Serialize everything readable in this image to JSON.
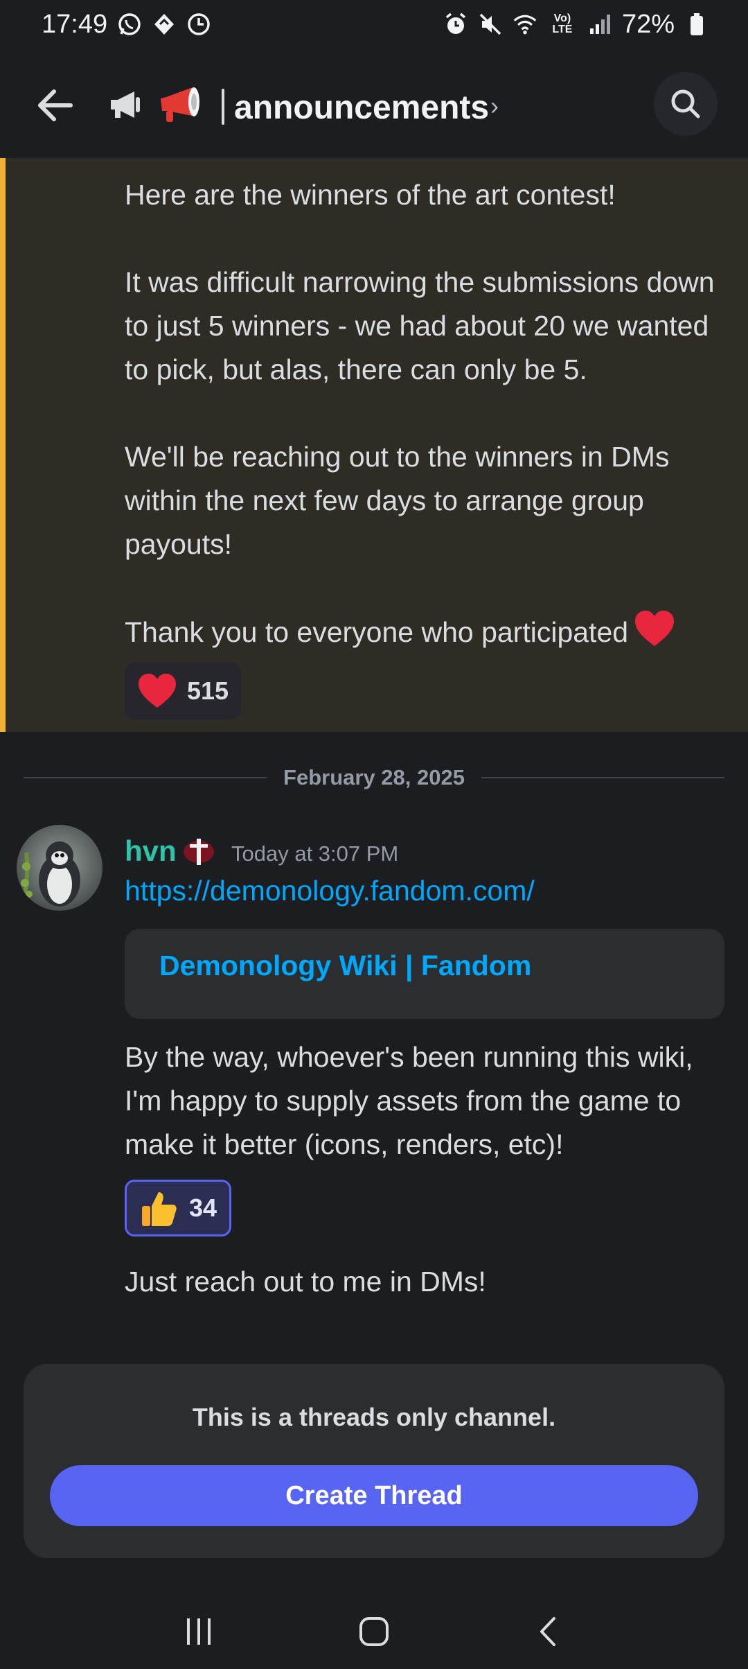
{
  "status_bar": {
    "time": "17:49",
    "battery": "72%",
    "icons_left": [
      "whatsapp-icon",
      "diamond-app-icon",
      "clock-icon"
    ],
    "icons_right": [
      "alarm-icon",
      "mute-icon",
      "wifi-icon",
      "volte-icon",
      "signal-icon",
      "battery-icon"
    ],
    "volte_label": "Vo) LTE"
  },
  "header": {
    "channel_name": "announcements",
    "chevron": "›"
  },
  "announcement": {
    "text": "Here are the winners of the art contest!\n\nIt was difficult narrowing the submissions down to just 5 winners - we had about 20 we wanted to pick, but alas, there can only be 5.\n\nWe'll be reaching out to the winners in DMs within the next few days to arrange group payouts!\n\nThank you to everyone who participated",
    "reaction": {
      "emoji": "heart",
      "count": "515"
    },
    "accent_color": "#f0b232"
  },
  "divider": {
    "date": "February 28, 2025"
  },
  "message": {
    "username": "hvn",
    "username_color": "#2fc4a8",
    "timestamp": "Today at 3:07 PM",
    "link": "https://demonology.fandom.com/",
    "embed_title": "Demonology Wiki | Fandom",
    "text1": "By the way, whoever's been running this wiki, I'm happy to supply assets from the game to make it better (icons, renders, etc)!",
    "reaction": {
      "emoji": "thumbs-up",
      "count": "34"
    },
    "text2": "Just reach out to me in DMs!"
  },
  "bottom_panel": {
    "note": "This is a threads only channel.",
    "button_label": "Create Thread"
  },
  "nav_bar": {
    "buttons": [
      "recent-apps",
      "home",
      "back"
    ]
  },
  "colors": {
    "background": "#1c1d21",
    "link": "#00a8fc",
    "blurple": "#5865f2"
  }
}
